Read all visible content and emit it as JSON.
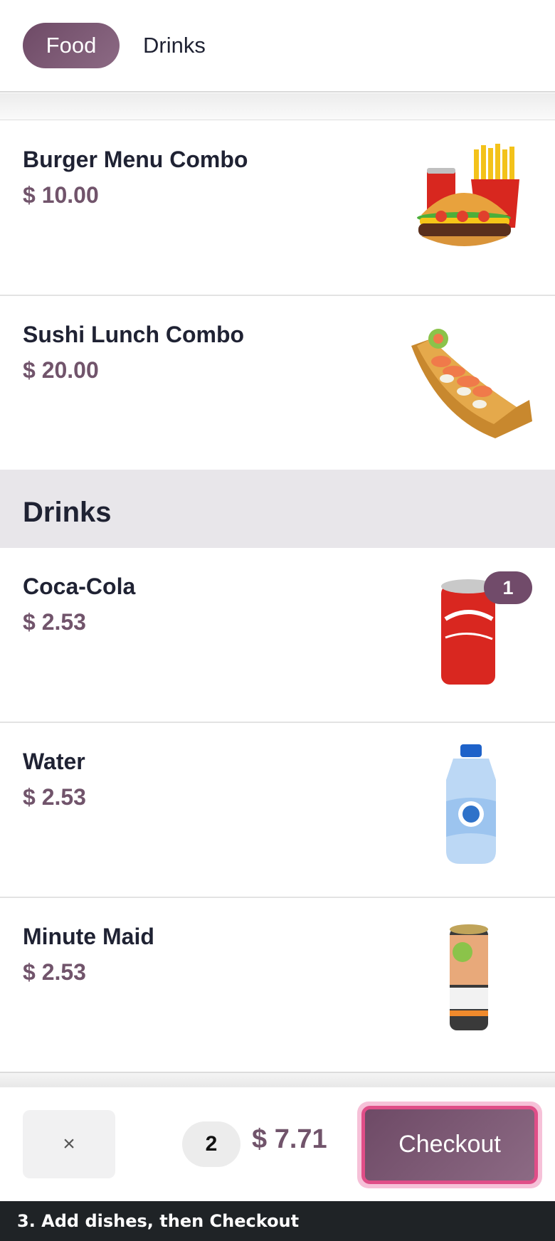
{
  "tabs": [
    {
      "label": "Food",
      "active": true
    },
    {
      "label": "Drinks",
      "active": false
    }
  ],
  "food_items": [
    {
      "name": "Burger Menu Combo",
      "price": "$ 10.00",
      "icon": "burger-combo-image"
    },
    {
      "name": "Sushi Lunch Combo",
      "price": "$ 20.00",
      "icon": "sushi-boat-image"
    }
  ],
  "section": {
    "title": "Drinks"
  },
  "drink_items": [
    {
      "name": "Coca-Cola",
      "price": "$ 2.53",
      "badge": "1",
      "icon": "coca-cola-can-image"
    },
    {
      "name": "Water",
      "price": "$ 2.53",
      "icon": "water-bottle-image"
    },
    {
      "name": "Minute Maid",
      "price": "$ 2.53",
      "icon": "minute-maid-can-image"
    }
  ],
  "cart": {
    "clear_label": "×",
    "count": "2",
    "total": "$ 7.71",
    "checkout_label": "Checkout"
  },
  "footer": {
    "instruction": "3. Add dishes, then Checkout"
  },
  "colors": {
    "accent": "#714b6a",
    "highlight": "#e04e88"
  }
}
